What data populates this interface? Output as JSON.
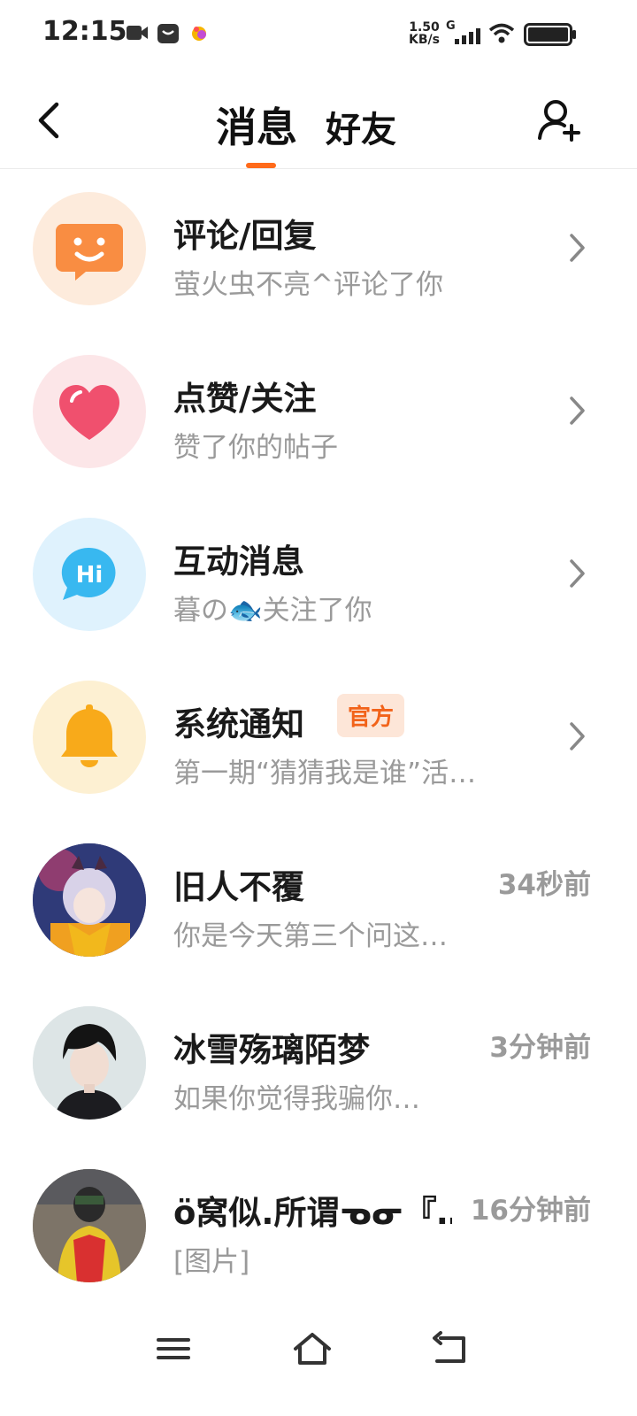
{
  "status_bar": {
    "time": "12:15",
    "net_speed_value": "1.50",
    "net_speed_unit": "KB/s",
    "signal_type": "G",
    "icons": [
      "video-icon",
      "notification-app-icon",
      "app-icon",
      "signal-icon",
      "wifi-icon",
      "battery-icon"
    ]
  },
  "header": {
    "tab_messages": "消息",
    "tab_friends": "好友",
    "active_tab": "消息",
    "accent_color": "#ff6a1a"
  },
  "system_items": [
    {
      "title": "评论/回复",
      "subtitle": "萤火虫不亮^评论了你",
      "icon": "comment-smile-icon",
      "bg_color": "#fdebdc"
    },
    {
      "title": "点赞/关注",
      "subtitle": "赞了你的帖子",
      "icon": "heart-icon",
      "bg_color": "#fce6e8"
    },
    {
      "title": "互动消息",
      "subtitle": "暮の🐟关注了你",
      "icon": "hi-bubble-icon",
      "bg_color": "#dff2fd"
    },
    {
      "title": "系统通知",
      "badge": "官方",
      "subtitle": "第一期“猜猜我是谁”活…",
      "icon": "bell-icon",
      "bg_color": "#fdf0d2"
    }
  ],
  "conversations": [
    {
      "name": "旧人不覆",
      "time": "34秒前",
      "preview": "你是今天第三个问这…"
    },
    {
      "name": "冰雪殇璃陌梦",
      "time": "3分钟前",
      "preview": "如果你觉得我骗你…"
    },
    {
      "name": "ö窝似.所谓ᓀᓂ『…",
      "time": "16分钟前",
      "preview": "[图片]"
    }
  ],
  "nav_bar": {
    "buttons": [
      "menu-icon",
      "home-icon",
      "back-icon"
    ]
  }
}
